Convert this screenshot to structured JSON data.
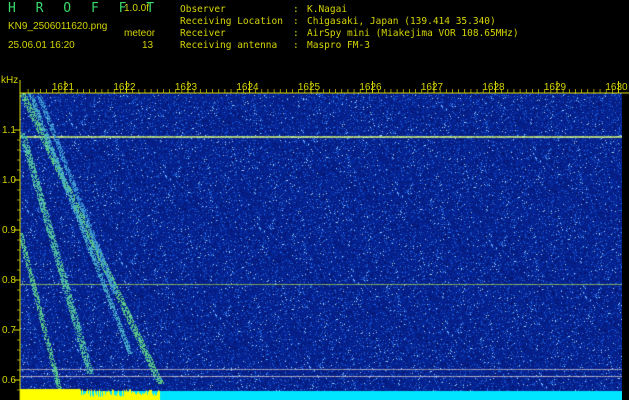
{
  "header": {
    "app_title": "H R O F F T",
    "version": "1.0.0f",
    "filename": "KN9_2506011620.png",
    "datetime": "25.06.01 16:20",
    "mode": "meteor",
    "count": "13"
  },
  "info": [
    {
      "key": "Observer",
      "value": "K.Nagai"
    },
    {
      "key": "Receiving Location",
      "value": "Chigasaki, Japan (139.414 35.340)"
    },
    {
      "key": "Receiver",
      "value": "AirSpy mini (Miakejima VOR 108.65MHz)"
    },
    {
      "key": "Receiving antenna",
      "value": "Maspro FM-3"
    }
  ],
  "axis": {
    "unit": "kHz",
    "y_ticks": [
      "1.1",
      "1.0",
      "0.9",
      "0.8",
      "0.7",
      "0.6"
    ],
    "x_ticks": [
      "1621",
      "1622",
      "1623",
      "1624",
      "1625",
      "1626",
      "1627",
      "1628",
      "1629",
      "1630"
    ]
  },
  "colors": {
    "text": "#d4d400",
    "title": "#39d96a",
    "background": "#000000",
    "spectrogram_base": "#0a1c8c",
    "signal_line": "#c8f0a0",
    "noise_bar": "#00e5ff",
    "noise_peak": "#ffff00"
  }
}
